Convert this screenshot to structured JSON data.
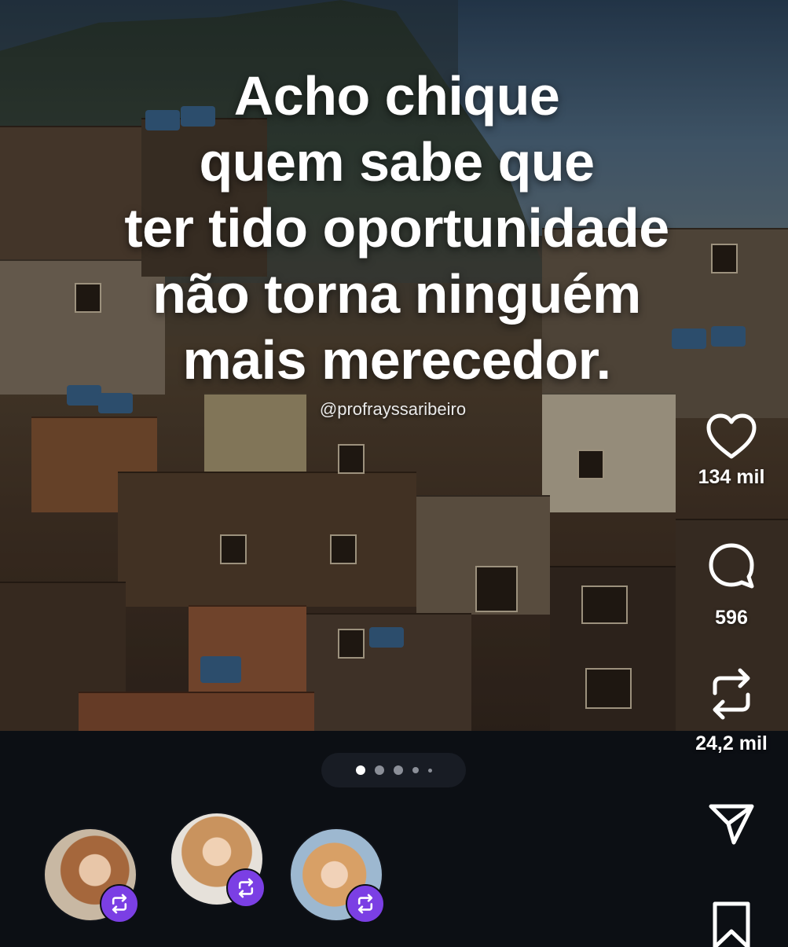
{
  "post": {
    "quote_lines": [
      "Acho chique",
      "quem sabe que",
      "ter tido oportunidade",
      "não torna ninguém",
      "mais merecedor."
    ],
    "author_handle": "@profrayssaribeiro"
  },
  "actions": {
    "likes": "134 mil",
    "comments": "596",
    "reposts": "24,2 mil"
  },
  "pagination": {
    "total": 5,
    "current": 1
  },
  "reposters": [
    {
      "name": "reposter-1",
      "badge_icon": "repost-icon"
    },
    {
      "name": "reposter-2",
      "badge_icon": "repost-icon"
    },
    {
      "name": "reposter-3",
      "badge_icon": "repost-icon"
    }
  ],
  "colors": {
    "accent": "#7b3fe4",
    "background": "#0c0f14"
  }
}
